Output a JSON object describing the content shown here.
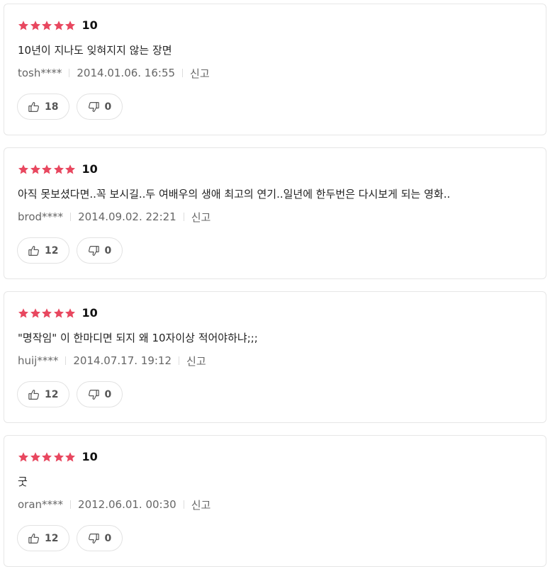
{
  "colors": {
    "star": "#e8475f",
    "border": "#e6e6e6",
    "meta_text": "#666666"
  },
  "icons": {
    "star": "star-icon",
    "like": "thumbs-up-icon",
    "dislike": "thumbs-down-icon"
  },
  "reviews": [
    {
      "stars": 5,
      "score": "10",
      "text": "10년이 지나도 잊혀지지 않는 장면",
      "user": "tosh****",
      "date": "2014.01.06. 16:55",
      "report_label": "신고",
      "likes": "18",
      "dislikes": "0"
    },
    {
      "stars": 5,
      "score": "10",
      "text": "아직 못보셨다면..꼭 보시길..두 여배우의 생애 최고의 연기..일년에 한두번은 다시보게 되는 영화..",
      "user": "brod****",
      "date": "2014.09.02. 22:21",
      "report_label": "신고",
      "likes": "12",
      "dislikes": "0"
    },
    {
      "stars": 5,
      "score": "10",
      "text": "\"명작임\" 이 한마디면 되지 왜 10자이상 적어야하냐;;;",
      "user": "huij****",
      "date": "2014.07.17. 19:12",
      "report_label": "신고",
      "likes": "12",
      "dislikes": "0"
    },
    {
      "stars": 5,
      "score": "10",
      "text": "굿",
      "user": "oran****",
      "date": "2012.06.01. 00:30",
      "report_label": "신고",
      "likes": "12",
      "dislikes": "0"
    }
  ]
}
